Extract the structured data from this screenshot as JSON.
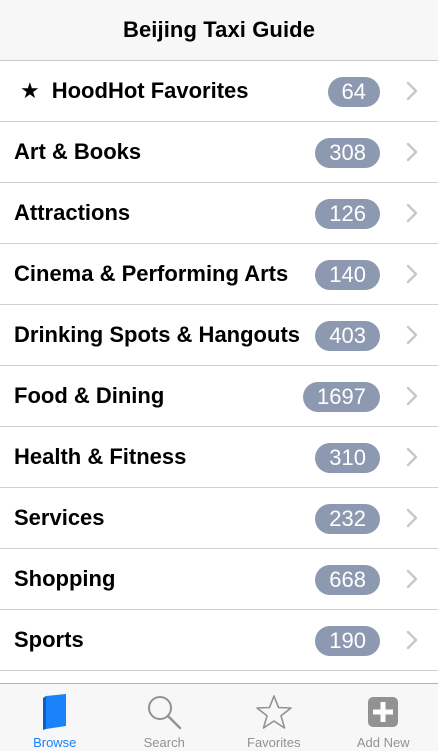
{
  "nav": {
    "title": "Beijing Taxi Guide"
  },
  "list": {
    "favorites": {
      "star": "★",
      "label": "HoodHot Favorites",
      "count": "64"
    },
    "items": [
      {
        "label": "Art & Books",
        "count": "308"
      },
      {
        "label": "Attractions",
        "count": "126"
      },
      {
        "label": "Cinema & Performing Arts",
        "count": "140"
      },
      {
        "label": "Drinking Spots & Hangouts",
        "count": "403"
      },
      {
        "label": "Food & Dining",
        "count": "1697"
      },
      {
        "label": "Health & Fitness",
        "count": "310"
      },
      {
        "label": "Services",
        "count": "232"
      },
      {
        "label": "Shopping",
        "count": "668"
      },
      {
        "label": "Sports",
        "count": "190"
      }
    ]
  },
  "tabbar": {
    "tabs": [
      {
        "label": "Browse",
        "icon": "book-icon",
        "active": true
      },
      {
        "label": "Search",
        "icon": "magnifier-icon",
        "active": false
      },
      {
        "label": "Favorites",
        "icon": "star-outline-icon",
        "active": false
      },
      {
        "label": "Add New",
        "icon": "plus-square-icon",
        "active": false
      }
    ]
  },
  "colors": {
    "badge": "#8d99b0",
    "active_tab": "#1a82fb",
    "inactive_tab": "#929292"
  }
}
